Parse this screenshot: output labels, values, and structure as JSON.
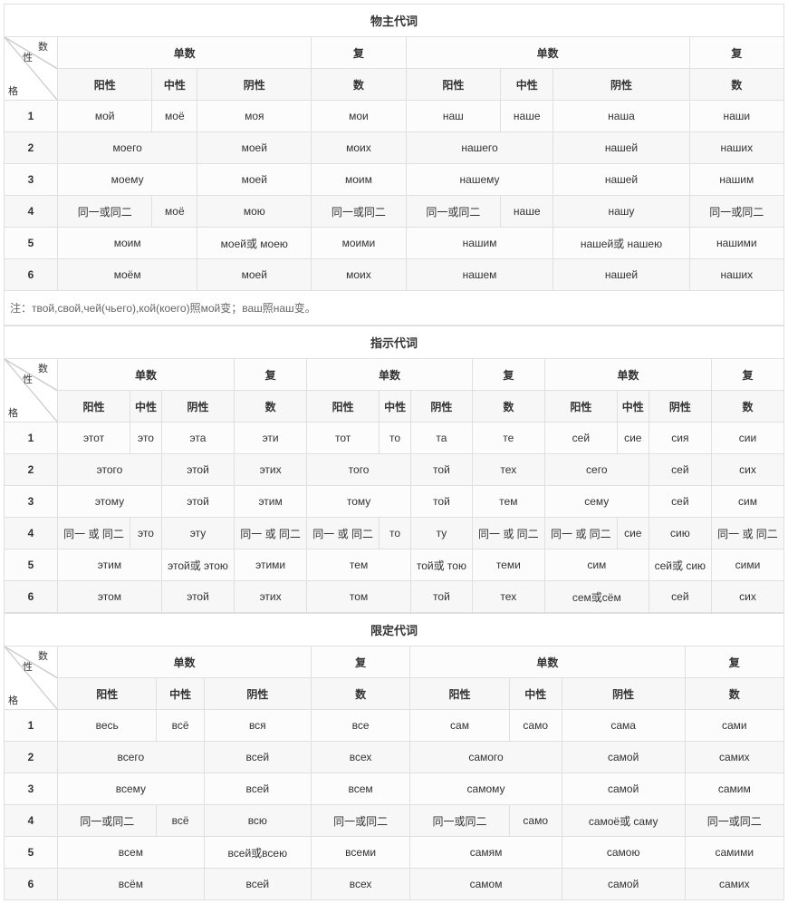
{
  "labels": {
    "singular": "单数",
    "plural_top": "复",
    "plural_bot": "数",
    "masc": "阳性",
    "neut": "中性",
    "fem": "阴性",
    "diag_num": "数",
    "diag_gen": "性",
    "diag_case": "格",
    "same12": "同一或同二",
    "same12b": "同一 或 同二"
  },
  "t1": {
    "title": "物主代词",
    "note": "注：твой,свой,чей(чьего),кой(коего)照мой变；ваш照наш变。",
    "chart_data": {
      "type": "table",
      "groups": [
        {
          "name": "мой",
          "forms": {
            "1": [
              "мой",
              "моё",
              "моя",
              "мои"
            ],
            "2": [
              "моего",
              "",
              "моей",
              "моих"
            ],
            "3": [
              "моему",
              "",
              "моей",
              "моим"
            ],
            "4": [
              "同一或同二",
              "моё",
              "мою",
              "同一或同二"
            ],
            "5": [
              "моим",
              "",
              "моей或 моею",
              "моими"
            ],
            "6": [
              "моём",
              "",
              "моей",
              "моих"
            ]
          }
        },
        {
          "name": "наш",
          "forms": {
            "1": [
              "наш",
              "наше",
              "наша",
              "наши"
            ],
            "2": [
              "нашего",
              "",
              "нашей",
              "наших"
            ],
            "3": [
              "нашему",
              "",
              "нашей",
              "нашим"
            ],
            "4": [
              "同一或同二",
              "наше",
              "нашу",
              "同一或同二"
            ],
            "5": [
              "нашим",
              "",
              "нашей或 нашею",
              "нашими"
            ],
            "6": [
              "нашем",
              "",
              "нашей",
              "наших"
            ]
          }
        }
      ]
    },
    "rows": [
      {
        "n": "1",
        "a1": "мой",
        "a2": "моё",
        "a3": "моя",
        "a4": "мои",
        "b1": "наш",
        "b2": "наше",
        "b3": "наша",
        "b4": "наши"
      },
      {
        "n": "2",
        "a12": "моего",
        "a3": "моей",
        "a4": "моих",
        "b12": "нашего",
        "b3": "нашей",
        "b4": "наших"
      },
      {
        "n": "3",
        "a12": "моему",
        "a3": "моей",
        "a4": "моим",
        "b12": "нашему",
        "b3": "нашей",
        "b4": "нашим"
      },
      {
        "n": "4",
        "a1": "同一或同二",
        "a2": "моё",
        "a3": "мою",
        "a4": "同一或同二",
        "b1": "同一或同二",
        "b2": "наше",
        "b3": "нашу",
        "b4": "同一或同二"
      },
      {
        "n": "5",
        "a12": "моим",
        "a3": "моей或 моею",
        "a4": "моими",
        "b12": "нашим",
        "b3": "нашей或 нашею",
        "b4": "нашими"
      },
      {
        "n": "6",
        "a12": "моём",
        "a3": "моей",
        "a4": "моих",
        "b12": "нашем",
        "b3": "нашей",
        "b4": "наших"
      }
    ]
  },
  "t2": {
    "title": "指示代词",
    "chart_data": {
      "type": "table"
    },
    "rows": [
      {
        "n": "1",
        "a": [
          "этот",
          "это",
          "эта",
          "эти"
        ],
        "b": [
          "тот",
          "то",
          "та",
          "те"
        ],
        "c": [
          "сей",
          "сие",
          "сия",
          "сии"
        ]
      },
      {
        "n": "2",
        "a12": "этого",
        "a3": "этой",
        "a4": "этих",
        "b12": "того",
        "b3": "той",
        "b4": "тех",
        "c12": "сего",
        "c3": "сей",
        "c4": "сих"
      },
      {
        "n": "3",
        "a12": "этому",
        "a3": "этой",
        "a4": "этим",
        "b12": "тому",
        "b3": "той",
        "b4": "тем",
        "c12": "сему",
        "c3": "сей",
        "c4": "сим"
      },
      {
        "n": "4",
        "a": [
          "同一 或 同二",
          "это",
          "эту",
          "同一 或 同二"
        ],
        "b": [
          "同一 或 同二",
          "то",
          "ту",
          "同一 或 同二"
        ],
        "c": [
          "同一 或 同二",
          "сие",
          "сию",
          "同一 或 同二"
        ]
      },
      {
        "n": "5",
        "a12": "этим",
        "a3": "этой或 этою",
        "a4": "этими",
        "b12": "тем",
        "b3": "той或 тою",
        "b4": "теми",
        "c12": "сим",
        "c3": "сей或 сию",
        "c4": "сими"
      },
      {
        "n": "6",
        "a12": "этом",
        "a3": "этой",
        "a4": "этих",
        "b12": "том",
        "b3": "той",
        "b4": "тех",
        "c12": "сем或сём",
        "c3": "сей",
        "c4": "сих"
      }
    ]
  },
  "t3": {
    "title": "限定代词",
    "chart_data": {
      "type": "table"
    },
    "rows": [
      {
        "n": "1",
        "a": [
          "весь",
          "всё",
          "вся",
          "все"
        ],
        "b": [
          "сам",
          "само",
          "сама",
          "сами"
        ]
      },
      {
        "n": "2",
        "a12": "всего",
        "a3": "всей",
        "a4": "всех",
        "b12": "самого",
        "b3": "самой",
        "b4": "самих"
      },
      {
        "n": "3",
        "a12": "всему",
        "a3": "всей",
        "a4": "всем",
        "b12": "самому",
        "b3": "самой",
        "b4": "самим"
      },
      {
        "n": "4",
        "a": [
          "同一或同二",
          "всё",
          "всю",
          "同一或同二"
        ],
        "b1": "同一或同二",
        "b2": "само",
        "b3": "самоё或 саму",
        "b4": "同一或同二"
      },
      {
        "n": "5",
        "a12": "всем",
        "a3": "всей或всею",
        "a4": "всеми",
        "b12": "самям",
        "b3": "самою",
        "b4": "самими"
      },
      {
        "n": "6",
        "a12": "всём",
        "a3": "всей",
        "a4": "всех",
        "b12": "самом",
        "b3": "самой",
        "b4": "самих"
      }
    ]
  }
}
